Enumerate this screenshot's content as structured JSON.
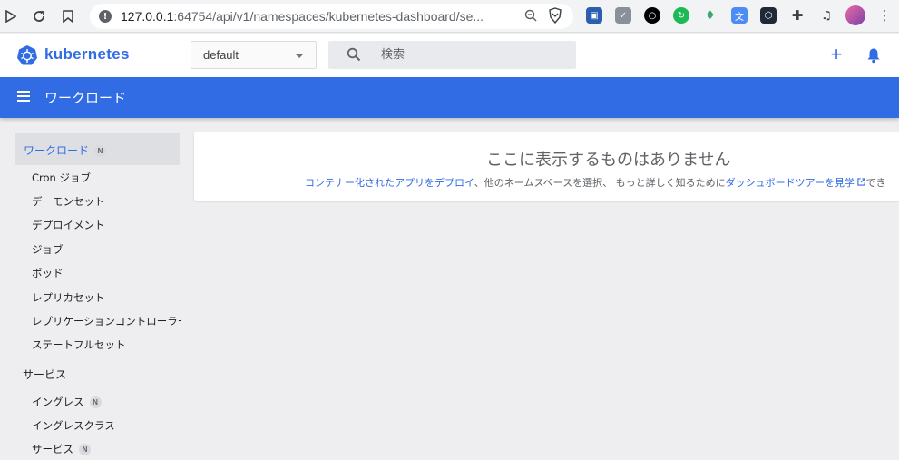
{
  "browser": {
    "url_host": "127.0.0.1",
    "url_rest": ":64754/api/v1/namespaces/kubernetes-dashboard/se..."
  },
  "header": {
    "brand": "kubernetes",
    "namespace": "default",
    "search_placeholder": "検索",
    "add_label": "+"
  },
  "toolbar": {
    "title": "ワークロード"
  },
  "sidebar": {
    "workloads": {
      "label": "ワークロード",
      "badge": "N"
    },
    "workload_items": [
      "Cron ジョブ",
      "デーモンセット",
      "デプロイメント",
      "ジョブ",
      "ポッド",
      "レプリカセット",
      "レプリケーションコントローラー",
      "ステートフルセット"
    ],
    "services_section": "サービス",
    "service_items": [
      {
        "label": "イングレス",
        "badge": "N"
      },
      {
        "label": "イングレスクラス",
        "badge": ""
      },
      {
        "label": "サービス",
        "badge": "N"
      }
    ]
  },
  "main": {
    "empty_title": "ここに表示するものはありません",
    "link_deploy": "コンテナー化されたアプリをデプロイ",
    "text_middle": "、他のネームスペースを選択、 もっと詳しく知るために",
    "link_tour": "ダッシュボードツアーを見学",
    "text_tail": "でき"
  }
}
